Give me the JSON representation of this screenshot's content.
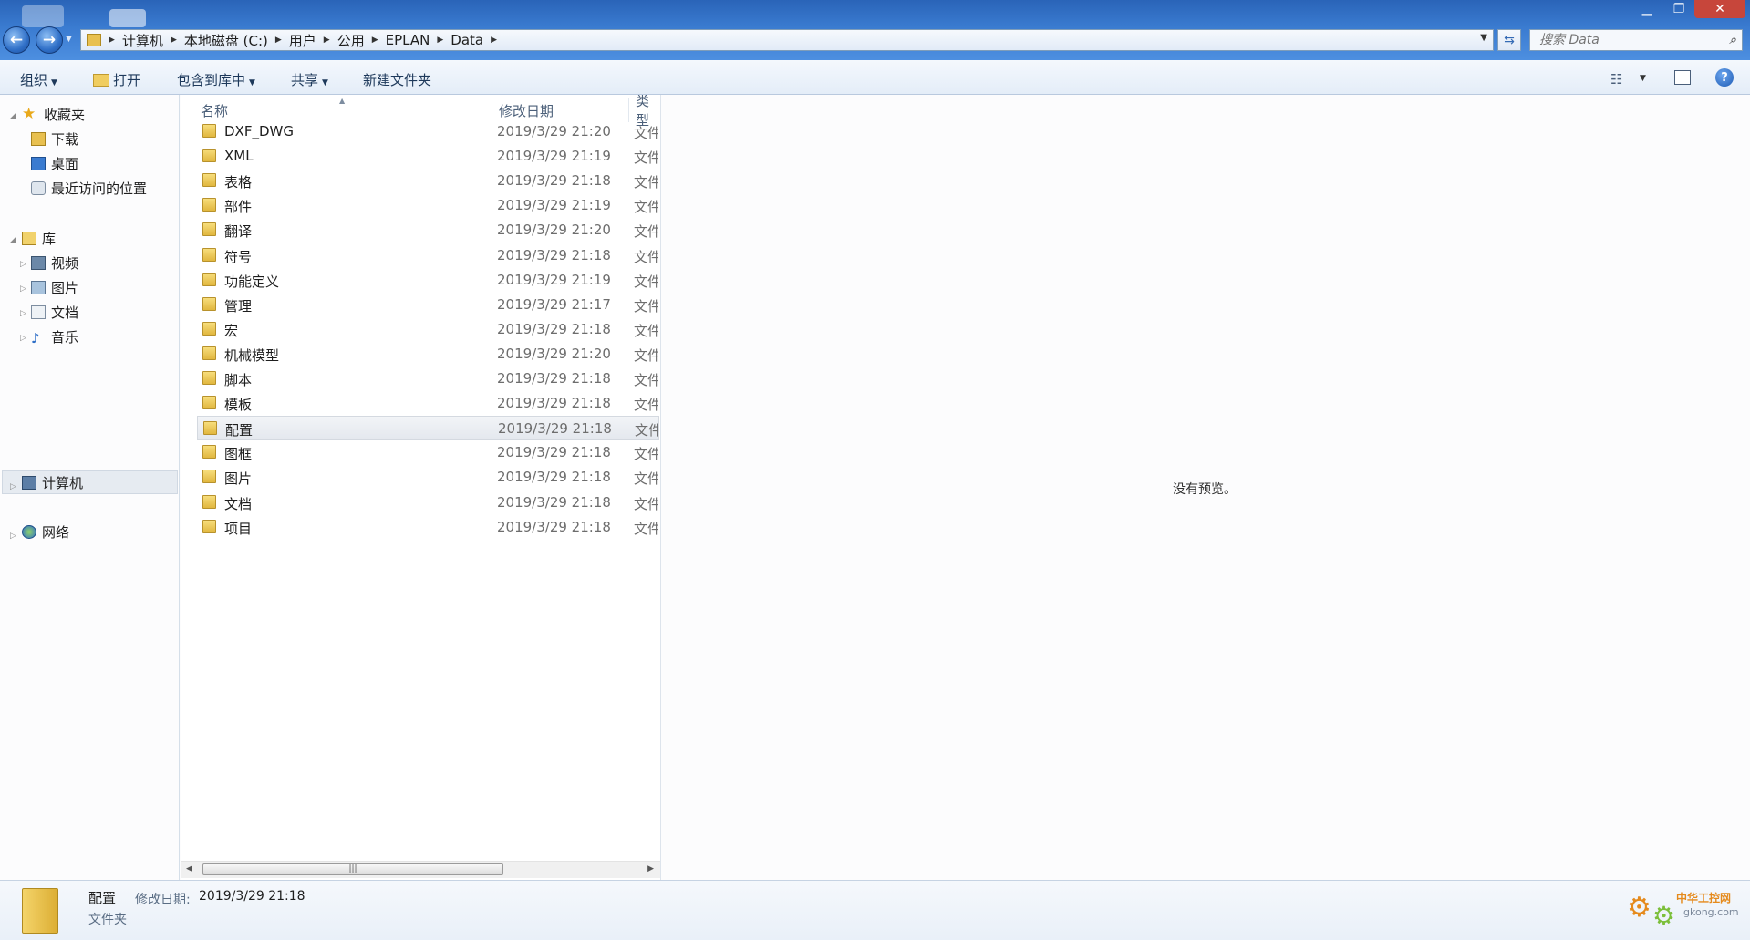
{
  "window": {
    "breadcrumb": [
      "计算机",
      "本地磁盘 (C:)",
      "用户",
      "公用",
      "EPLAN",
      "Data"
    ],
    "search_placeholder": "搜索 Data",
    "controls": {
      "minimize": "▁",
      "maximize": "❐",
      "close": "✕"
    }
  },
  "toolbar": {
    "organize": "组织",
    "open": "打开",
    "include_library": "包含到库中",
    "share": "共享",
    "new_folder": "新建文件夹"
  },
  "nav": {
    "favorites": "收藏夹",
    "downloads": "下载",
    "desktop": "桌面",
    "recent": "最近访问的位置",
    "libraries": "库",
    "videos": "视频",
    "pictures": "图片",
    "documents": "文档",
    "music": "音乐",
    "computer": "计算机",
    "network": "网络"
  },
  "list": {
    "headers": {
      "name": "名称",
      "date": "修改日期",
      "type": "类型"
    },
    "rows": [
      {
        "name": "DXF_DWG",
        "date": "2019/3/29 21:20",
        "type": "文件夹"
      },
      {
        "name": "XML",
        "date": "2019/3/29 21:19",
        "type": "文件夹"
      },
      {
        "name": "表格",
        "date": "2019/3/29 21:18",
        "type": "文件夹"
      },
      {
        "name": "部件",
        "date": "2019/3/29 21:19",
        "type": "文件夹"
      },
      {
        "name": "翻译",
        "date": "2019/3/29 21:20",
        "type": "文件夹"
      },
      {
        "name": "符号",
        "date": "2019/3/29 21:18",
        "type": "文件夹"
      },
      {
        "name": "功能定义",
        "date": "2019/3/29 21:19",
        "type": "文件夹"
      },
      {
        "name": "管理",
        "date": "2019/3/29 21:17",
        "type": "文件夹"
      },
      {
        "name": "宏",
        "date": "2019/3/29 21:18",
        "type": "文件夹"
      },
      {
        "name": "机械模型",
        "date": "2019/3/29 21:20",
        "type": "文件夹"
      },
      {
        "name": "脚本",
        "date": "2019/3/29 21:18",
        "type": "文件夹"
      },
      {
        "name": "模板",
        "date": "2019/3/29 21:18",
        "type": "文件夹"
      },
      {
        "name": "配置",
        "date": "2019/3/29 21:18",
        "type": "文件夹"
      },
      {
        "name": "图框",
        "date": "2019/3/29 21:18",
        "type": "文件夹"
      },
      {
        "name": "图片",
        "date": "2019/3/29 21:18",
        "type": "文件夹"
      },
      {
        "name": "文档",
        "date": "2019/3/29 21:18",
        "type": "文件夹"
      },
      {
        "name": "项目",
        "date": "2019/3/29 21:18",
        "type": "文件夹"
      }
    ],
    "scroll_grip": "|||"
  },
  "preview": {
    "text": "没有预览。"
  },
  "details": {
    "name": "配置",
    "date_label": "修改日期:",
    "date_value": "2019/3/29 21:18",
    "type": "文件夹"
  },
  "watermark": {
    "text": "中华工控网",
    "url": "gkong.com"
  },
  "colors": {
    "accent": "#2a64b8",
    "selected_row": "#e4e8ee",
    "folder": "#e1b73f"
  }
}
